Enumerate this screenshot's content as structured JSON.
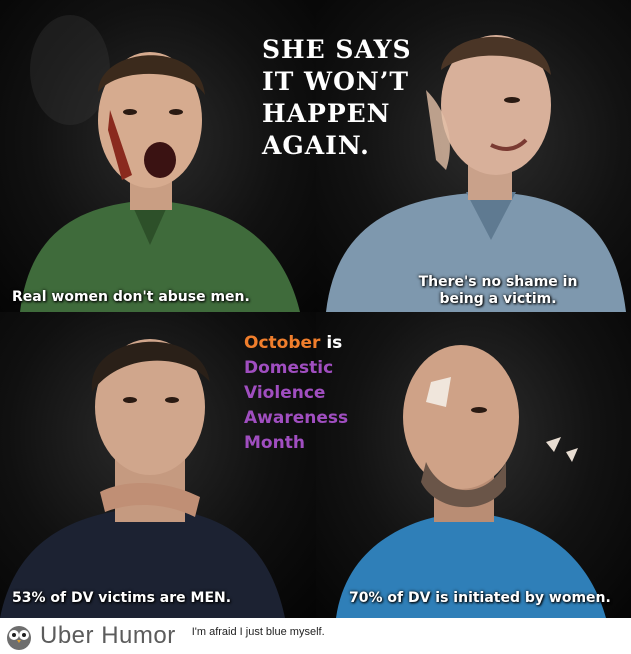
{
  "headline": [
    "SHE SAYS",
    "IT WON’T",
    "HAPPEN",
    "AGAIN."
  ],
  "captions": {
    "top_left": "Real women don't abuse men.",
    "top_right": [
      "There's no shame in",
      "being a victim."
    ],
    "bottom_left": "53% of DV victims are MEN.",
    "bottom_right": "70% of DV is initiated by women."
  },
  "awareness": {
    "month": "October",
    "is": " is",
    "lines": [
      "Domestic",
      "Violence",
      "Awareness",
      "Month"
    ]
  },
  "footer": {
    "brand": "Uber Humor",
    "tagline": "I'm afraid I just blue myself."
  },
  "colors": {
    "month_orange": "#f07e2c",
    "awareness_purple": "#a04ec0"
  }
}
